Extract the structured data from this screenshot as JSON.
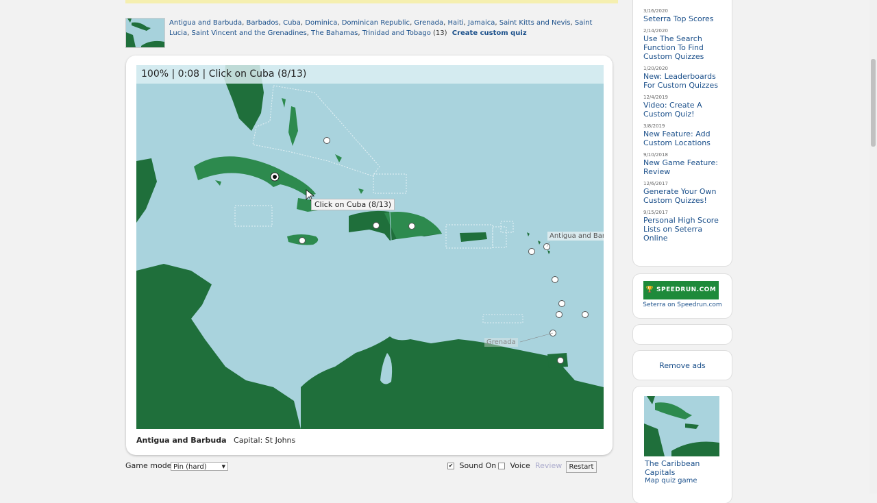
{
  "quiz": {
    "countries": [
      "Antigua and Barbuda",
      "Barbados",
      "Cuba",
      "Dominica",
      "Dominican Republic",
      "Grenada",
      "Haiti",
      "Jamaica",
      "Saint Kitts and Nevis",
      "Saint Lucia",
      "Saint Vincent and the Grenadines",
      "The Bahamas",
      "Trinidad and Tobago"
    ],
    "count": "(13)",
    "create_custom": "Create custom quiz"
  },
  "game": {
    "status": "100% | 0:08 | Click on Cuba (8/13)",
    "tooltip": "Click on Cuba (8/13)",
    "label_antigua": "Antigua and Bar",
    "label_grenada": "Grenada",
    "info_country": "Antigua and Barbuda",
    "info_capital": "Capital: St Johns"
  },
  "controls": {
    "game_mode_label": "Game mode:",
    "game_mode_value": "Pin (hard)",
    "sound_checked": "✔",
    "sound_label": "Sound On",
    "voice_label": "Voice",
    "review_label": "Review",
    "restart_label": "Restart"
  },
  "sidebar": {
    "news": [
      {
        "date": "3/16/2020",
        "title": "Seterra Top Scores"
      },
      {
        "date": "2/14/2020",
        "title": "Use The Search Function To Find Custom Quizzes"
      },
      {
        "date": "1/20/2020",
        "title": "New: Leaderboards For Custom Quizzes"
      },
      {
        "date": "12/4/2019",
        "title": "Video: Create A Custom Quiz!"
      },
      {
        "date": "3/8/2019",
        "title": "New Feature: Add Custom Locations"
      },
      {
        "date": "9/10/2018",
        "title": "New Game Feature: Review"
      },
      {
        "date": "12/6/2017",
        "title": "Generate Your Own Custom Quizzes!"
      },
      {
        "date": "9/15/2017",
        "title": "Personal High Score Lists on Seterra Online"
      }
    ],
    "speedrun_logo": "SPEEDRUN.COM",
    "speedrun_caption": "Seterra on Speedrun.com",
    "remove_ads": "Remove ads",
    "related_title": "The Caribbean Capitals",
    "related_subtitle": "Map quiz game"
  },
  "colors": {
    "sea": "#a9d3dd",
    "land_dark": "#1f6f3b",
    "land_quiz": "#2d8a4e"
  }
}
